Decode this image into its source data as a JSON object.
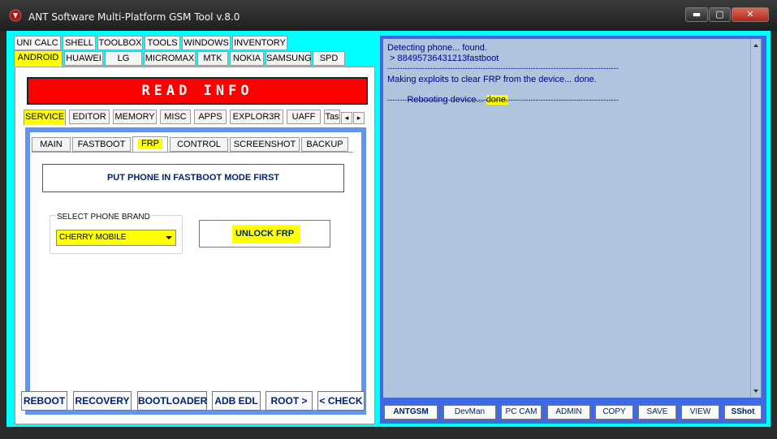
{
  "window": {
    "title": "ANT Software Multi-Platform GSM Tool  v.8.0",
    "min": "▬",
    "max": "▢",
    "close": "✕"
  },
  "top_tabs_row1": [
    "UNI CALC",
    "SHELL",
    "TOOLBOX",
    "TOOLS",
    "WINDOWS",
    "INVENTORY"
  ],
  "top_tabs_row2": [
    "ANDROID",
    "HUAWEI",
    "LG",
    "MICROMAX",
    "MTK",
    "NOKIA",
    "SAMSUNG",
    "SPD"
  ],
  "read_info": "READ INFO",
  "service_tabs": [
    "SERVICE",
    "EDITOR",
    "MEMORY",
    "MISC",
    "APPS",
    "EXPLOR3R",
    "UAFF",
    "Tas"
  ],
  "scroll_left": "◂",
  "scroll_right": "▸",
  "frp_tabs": [
    "MAIN",
    "FASTBOOT",
    "FRP",
    "CONTROL",
    "SCREENSHOT",
    "BACKUP"
  ],
  "frp": {
    "warning": "PUT PHONE IN FASTBOOT MODE FIRST",
    "brand_group_label": "SELECT PHONE BRAND",
    "brand_selected": "CHERRY MOBILE",
    "unlock_label": "UNLOCK FRP"
  },
  "bottom_buttons": [
    "REBOOT",
    "RECOVERY",
    "BOOTLOADER",
    "ADB EDL",
    "ROOT >",
    "< CHECK"
  ],
  "log": {
    "line1": "Detecting phone... found.",
    "line2": " > 88495736431213fastboot",
    "sep": "--------------------------------------------------------------------------------------------",
    "line3": "Making exploits to clear FRP from the device... done.",
    "line4_prefix": "Rebooting device... ",
    "line4_done": "done.",
    "sep2": "--------------------------------------------------------------------------------------------"
  },
  "log_buttons": [
    "ANTGSM",
    "DevMan",
    "PC CAM",
    "ADMIN",
    "COPY",
    "SAVE",
    "VIEW",
    "SShot"
  ],
  "colors": {
    "cyan": "#00ffff",
    "red": "#ff0000",
    "highlight": "#ffff00",
    "log_bg": "#b0c4de",
    "frame_blue": "#4169e1"
  }
}
